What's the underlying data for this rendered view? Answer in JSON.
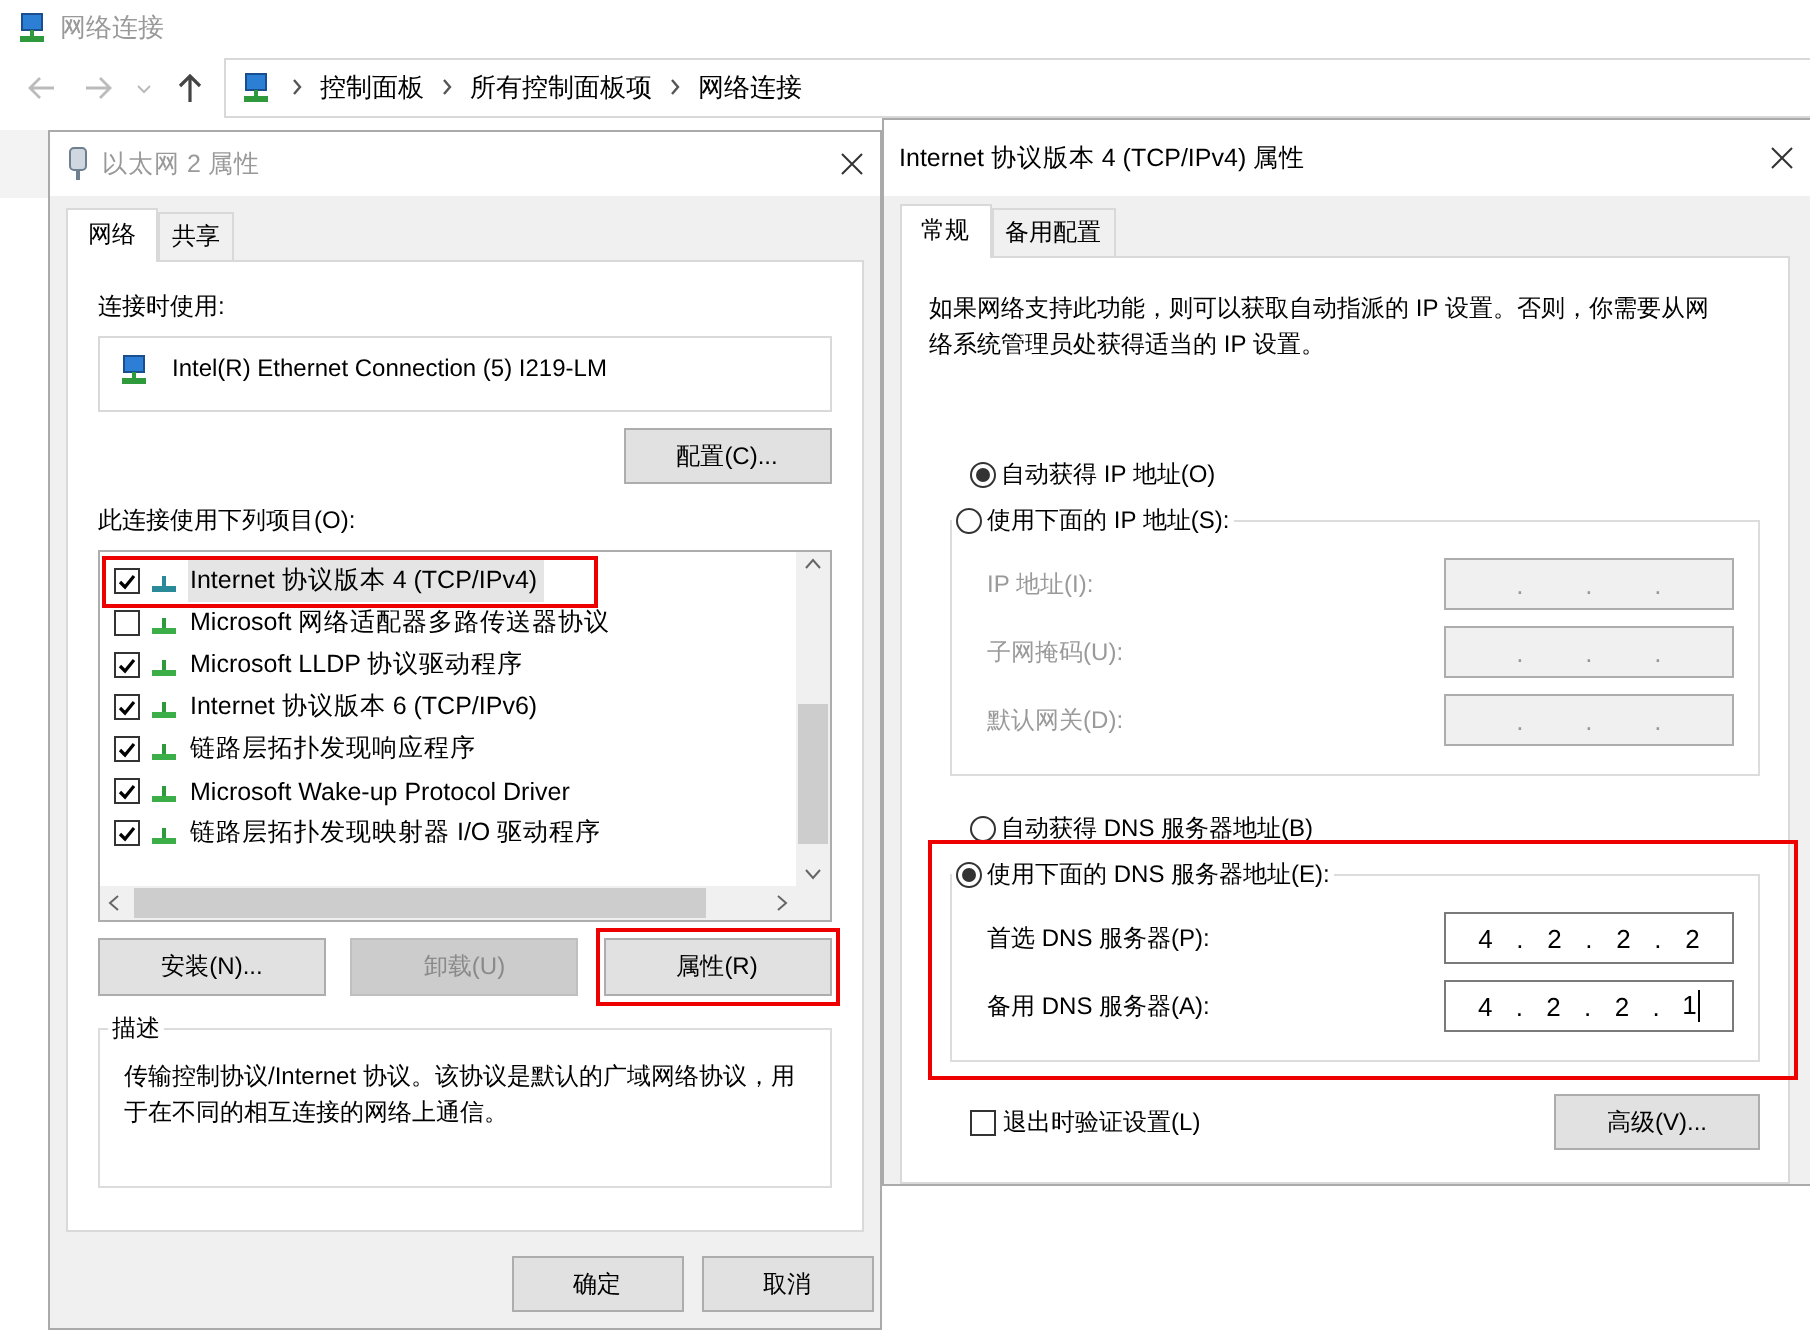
{
  "explorer": {
    "title": "网络连接",
    "breadcrumb": [
      "控制面板",
      "所有控制面板项",
      "网络连接"
    ]
  },
  "adapter_dialog": {
    "title": "以太网 2 属性",
    "active": false,
    "tabs": [
      {
        "label": "网络",
        "selected": true
      },
      {
        "label": "共享",
        "selected": false
      }
    ],
    "connect_using_label": "连接时使用:",
    "adapter": "Intel(R) Ethernet Connection (5) I219-LM",
    "configure_button": "配置(C)...",
    "items_label": "此连接使用下列项目(O):",
    "items": [
      {
        "label": "Internet 协议版本 4 (TCP/IPv4)",
        "checked": true,
        "selected": true,
        "highlighted": true
      },
      {
        "label": "Microsoft 网络适配器多路传送器协议",
        "checked": false,
        "selected": false,
        "highlighted": false
      },
      {
        "label": "Microsoft LLDP 协议驱动程序",
        "checked": true,
        "selected": false,
        "highlighted": false
      },
      {
        "label": "Internet 协议版本 6 (TCP/IPv6)",
        "checked": true,
        "selected": false,
        "highlighted": false
      },
      {
        "label": "链路层拓扑发现响应程序",
        "checked": true,
        "selected": false,
        "highlighted": false
      },
      {
        "label": "Microsoft Wake-up Protocol Driver",
        "checked": true,
        "selected": false,
        "highlighted": false
      },
      {
        "label": "链路层拓扑发现映射器 I/O 驱动程序",
        "checked": true,
        "selected": false,
        "highlighted": false
      }
    ],
    "buttons": [
      {
        "label": "安装(N)...",
        "disabled": false,
        "highlighted": false
      },
      {
        "label": "卸载(U)",
        "disabled": true,
        "highlighted": false
      },
      {
        "label": "属性(R)",
        "disabled": false,
        "highlighted": true
      }
    ],
    "description_title": "描述",
    "description": "传输控制协议/Internet 协议。该协议是默认的广域网络协议，用于在不同的相互连接的网络上通信。",
    "footer_buttons": [
      "确定",
      "取消"
    ]
  },
  "ipv4_dialog": {
    "title": "Internet 协议版本 4 (TCP/IPv4) 属性",
    "active": true,
    "tabs": [
      {
        "label": "常规",
        "selected": true
      },
      {
        "label": "备用配置",
        "selected": false
      }
    ],
    "intro": "如果网络支持此功能，则可以获取自动指派的 IP 设置。否则，你需要从网络系统管理员处获得适当的 IP 设置。",
    "separator": ".",
    "ip_auto_radio": {
      "label": "自动获得 IP 地址(O)",
      "selected": true
    },
    "ip_group": {
      "radio": {
        "label": "使用下面的 IP 地址(S):",
        "selected": false
      },
      "fields": [
        {
          "label": "IP 地址(I):",
          "disabled": true
        },
        {
          "label": "子网掩码(U):",
          "disabled": true
        },
        {
          "label": "默认网关(D):",
          "disabled": true
        }
      ]
    },
    "dns_auto_radio": {
      "label": "自动获得 DNS 服务器地址(B)",
      "selected": false
    },
    "dns_group": {
      "radio": {
        "label": "使用下面的 DNS 服务器地址(E):",
        "selected": true
      },
      "highlighted": true,
      "fields": [
        {
          "label": "首选 DNS 服务器(P):",
          "disabled": false,
          "focused": false,
          "octets": [
            "4",
            "2",
            "2",
            "2"
          ]
        },
        {
          "label": "备用 DNS 服务器(A):",
          "disabled": false,
          "focused": true,
          "octets": [
            "4",
            "2",
            "2",
            "1"
          ]
        }
      ]
    },
    "validate_checkbox": {
      "label": "退出时验证设置(L)",
      "checked": false
    },
    "advanced_button": "高级(V)..."
  }
}
